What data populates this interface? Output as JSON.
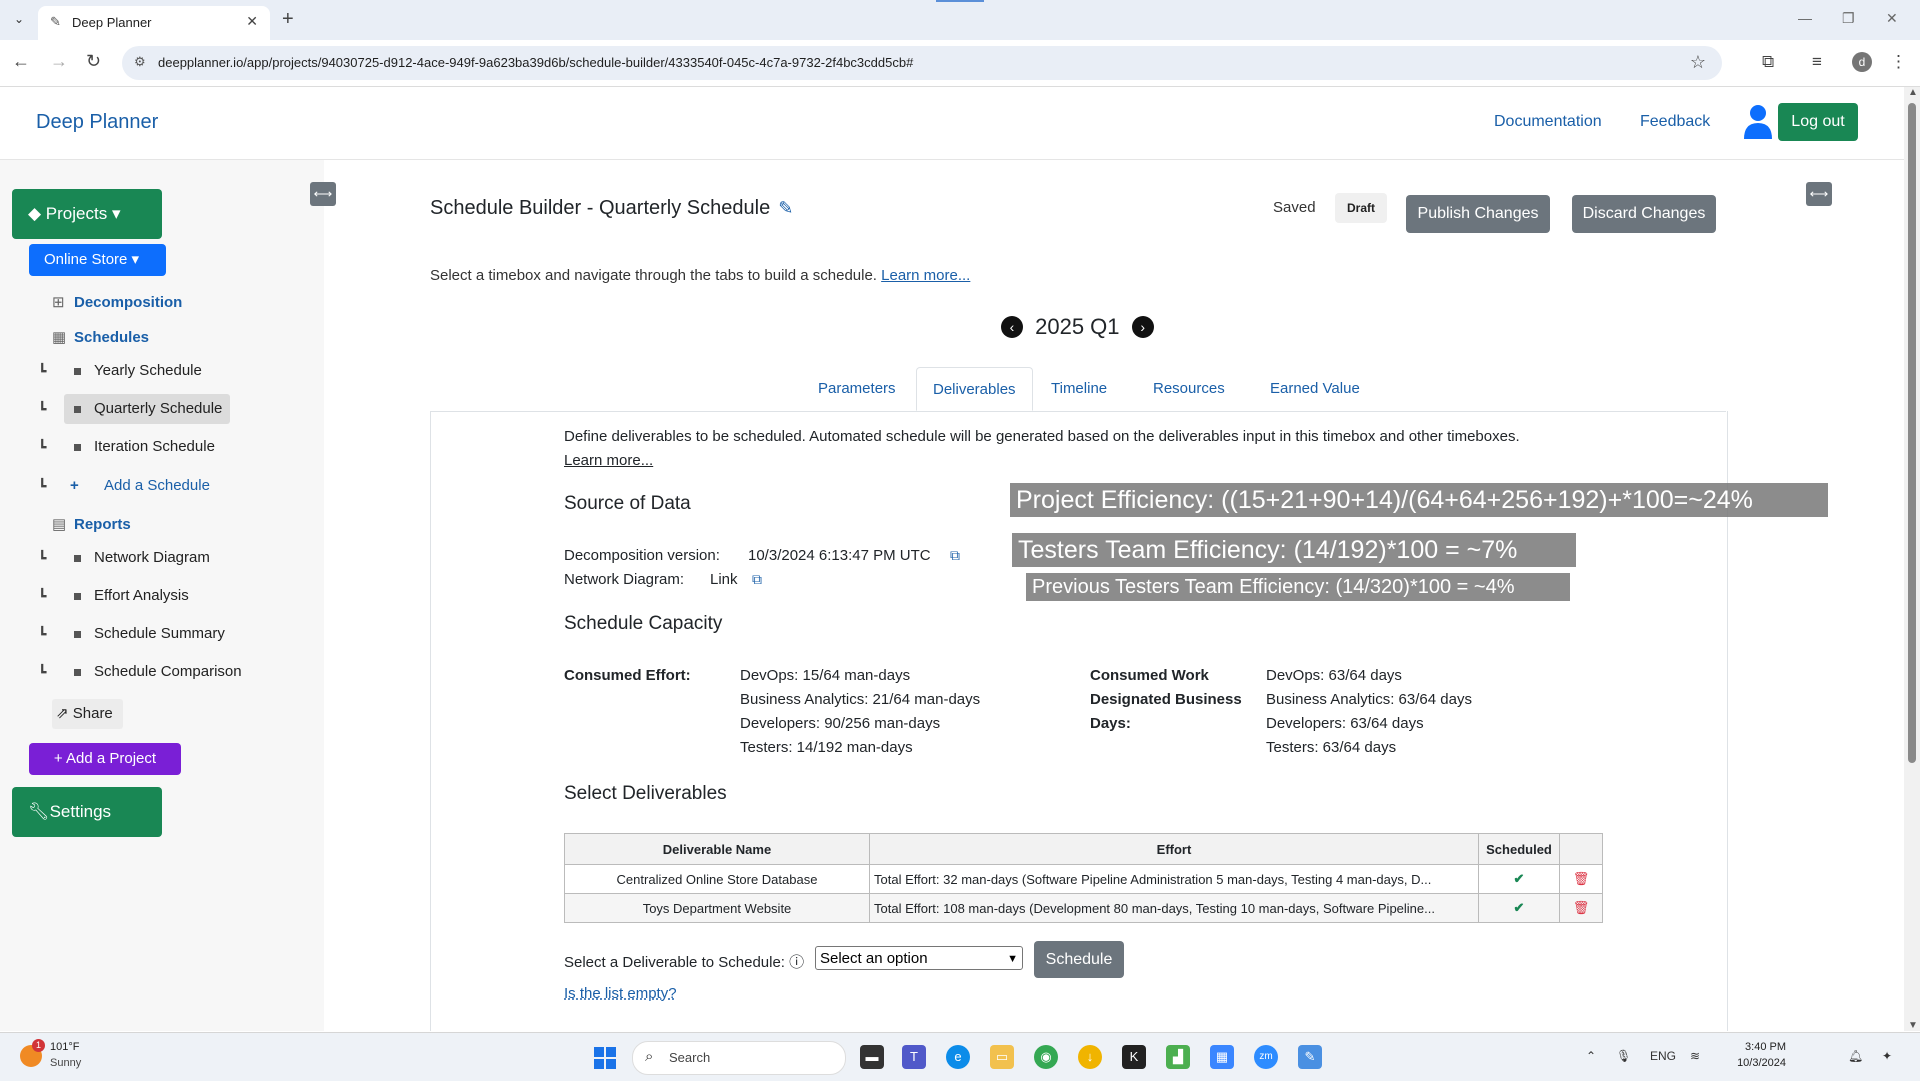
{
  "browser": {
    "tab_title": "Deep Planner",
    "url": "deepplanner.io/app/projects/94030725-d912-4ace-949f-9a623ba39d6b/schedule-builder/4333540f-045c-4c7a-9732-2f4bc3cdd5cb#"
  },
  "app": {
    "brand": "Deep Planner",
    "nav_documentation": "Documentation",
    "nav_feedback": "Feedback",
    "logout": "Log out"
  },
  "sidebar": {
    "projects": "Projects",
    "store": "Online Store",
    "decomposition": "Decomposition",
    "schedules": "Schedules",
    "schedule_items": [
      "Yearly Schedule",
      "Quarterly Schedule",
      "Iteration Schedule"
    ],
    "add_schedule": "Add a Schedule",
    "reports": "Reports",
    "report_items": [
      "Network Diagram",
      "Effort Analysis",
      "Schedule Summary",
      "Schedule Comparison"
    ],
    "share": "Share",
    "add_project": "Add a Project",
    "settings": "Settings"
  },
  "main": {
    "title": "Schedule Builder - Quarterly Schedule",
    "saved": "Saved",
    "draft": "Draft",
    "publish": "Publish Changes",
    "discard": "Discard Changes",
    "intro": "Select a timebox and navigate through the tabs to build a schedule.",
    "learn_more": "Learn more...",
    "timebox": "2025 Q1",
    "tabs": [
      "Parameters",
      "Deliverables",
      "Timeline",
      "Resources",
      "Earned Value"
    ],
    "define_text": "Define deliverables to be scheduled. Automated schedule will be generated based on the deliverables input in this timebox and other timeboxes.",
    "define_learn": "Learn more...",
    "source_heading": "Source of Data",
    "decomp_label": "Decomposition version:",
    "decomp_value": "10/3/2024 6:13:47 PM UTC",
    "network_label": "Network Diagram:",
    "network_value": "Link",
    "capacity_heading": "Schedule Capacity",
    "consumed_effort_label": "Consumed Effort:",
    "consumed_effort": [
      "DevOps: 15/64 man-days",
      "Business Analytics: 21/64 man-days",
      "Developers: 90/256 man-days",
      "Testers: 14/192 man-days"
    ],
    "consumed_work_label": [
      "Consumed Work",
      "Designated Business",
      "Days:"
    ],
    "consumed_work": [
      "DevOps: 63/64 days",
      "Business Analytics: 63/64 days",
      "Developers: 63/64 days",
      "Testers: 63/64 days"
    ],
    "select_heading": "Select Deliverables",
    "table_headers": [
      "Deliverable Name",
      "Effort",
      "Scheduled"
    ],
    "rows": [
      {
        "name": "Centralized Online Store Database",
        "effort": "Total Effort: 32 man-days (Software Pipeline Administration 5 man-days, Testing 4 man-days, D..."
      },
      {
        "name": "Toys Department Website",
        "effort": "Total Effort: 108 man-days (Development 80 man-days, Testing 10 man-days, Software Pipeline..."
      }
    ],
    "select_label": "Select a Deliverable to Schedule:",
    "select_value": "Select an option",
    "schedule_btn": "Schedule",
    "empty_link": "Is the list empty?"
  },
  "overlays": {
    "project_eff": "Project Efficiency: ((15+21+90+14)/(64+64+256+192)+*100=~24%",
    "testers_eff": "Testers Team Efficiency: (14/192)*100 = ~7%",
    "prev_testers_eff": "Previous Testers Team Efficiency: (14/320)*100 = ~4%"
  },
  "taskbar": {
    "temp": "101°F",
    "weather": "Sunny",
    "weather_badge": "1",
    "search": "Search",
    "lang": "ENG",
    "time": "3:40 PM",
    "date": "10/3/2024"
  }
}
